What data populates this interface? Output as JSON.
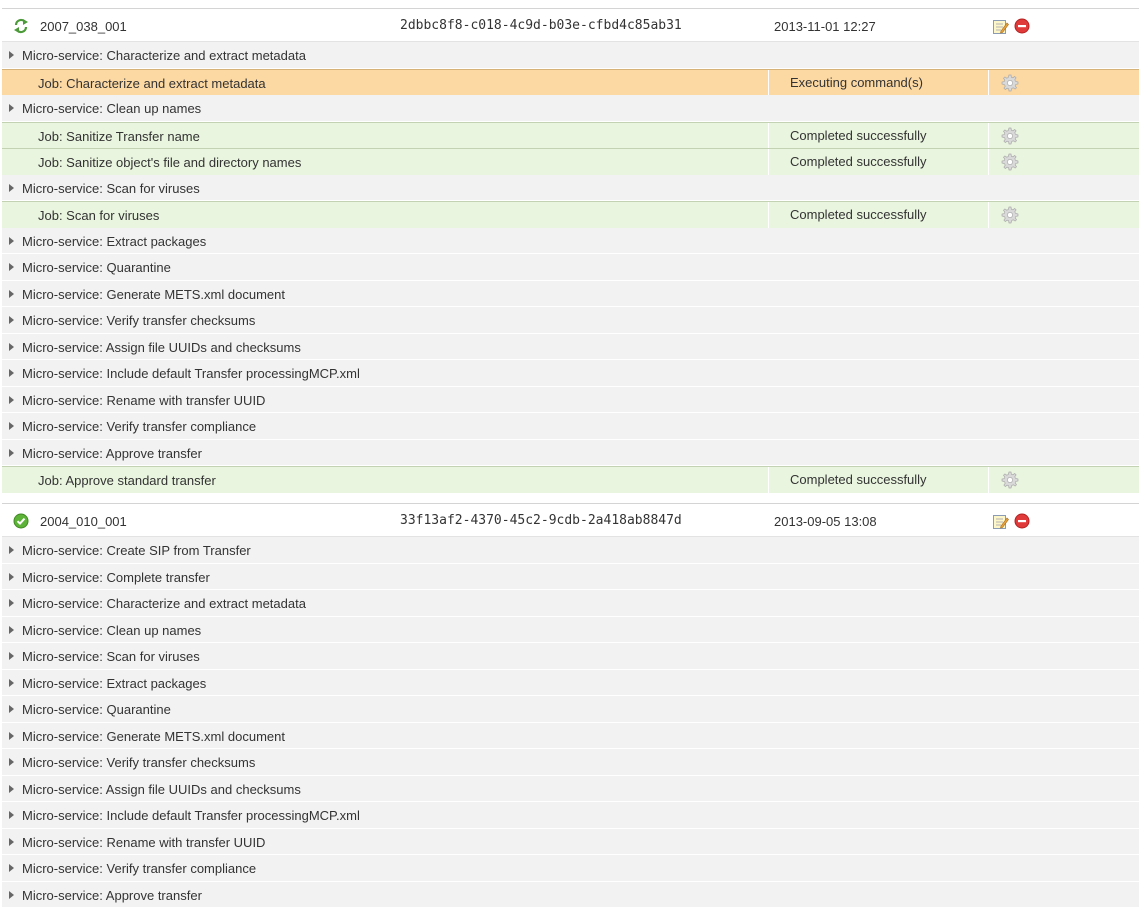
{
  "transfers": [
    {
      "name": "2007_038_001",
      "uuid": "2dbbc8f8-c018-4c9d-b03e-cfbd4c85ab31",
      "date": "2013-11-01 12:27",
      "status_icon": "refresh-processing-icon",
      "rows": [
        {
          "kind": "ms",
          "label": "Micro-service: Characterize and extract metadata"
        },
        {
          "kind": "job",
          "state": "executing",
          "label": "Job: Characterize and extract metadata",
          "status": "Executing command(s)"
        },
        {
          "kind": "ms",
          "label": "Micro-service: Clean up names"
        },
        {
          "kind": "job",
          "state": "done",
          "label": "Job: Sanitize Transfer name",
          "status": "Completed successfully"
        },
        {
          "kind": "job",
          "state": "done",
          "label": "Job: Sanitize object's file and directory names",
          "status": "Completed successfully"
        },
        {
          "kind": "ms",
          "label": "Micro-service: Scan for viruses"
        },
        {
          "kind": "job",
          "state": "done",
          "label": "Job: Scan for viruses",
          "status": "Completed successfully"
        },
        {
          "kind": "ms",
          "label": "Micro-service: Extract packages"
        },
        {
          "kind": "ms",
          "label": "Micro-service: Quarantine"
        },
        {
          "kind": "ms",
          "label": "Micro-service: Generate METS.xml document"
        },
        {
          "kind": "ms",
          "label": "Micro-service: Verify transfer checksums"
        },
        {
          "kind": "ms",
          "label": "Micro-service: Assign file UUIDs and checksums"
        },
        {
          "kind": "ms",
          "label": "Micro-service: Include default Transfer processingMCP.xml"
        },
        {
          "kind": "ms",
          "label": "Micro-service: Rename with transfer UUID"
        },
        {
          "kind": "ms",
          "label": "Micro-service: Verify transfer compliance"
        },
        {
          "kind": "ms",
          "label": "Micro-service: Approve transfer"
        },
        {
          "kind": "job",
          "state": "done",
          "label": "Job: Approve standard transfer",
          "status": "Completed successfully"
        }
      ]
    },
    {
      "name": "2004_010_001",
      "uuid": "33f13af2-4370-45c2-9cdb-2a418ab8847d",
      "date": "2013-09-05 13:08",
      "status_icon": "check-circle-icon",
      "rows": [
        {
          "kind": "ms",
          "label": "Micro-service: Create SIP from Transfer"
        },
        {
          "kind": "ms",
          "label": "Micro-service: Complete transfer"
        },
        {
          "kind": "ms",
          "label": "Micro-service: Characterize and extract metadata"
        },
        {
          "kind": "ms",
          "label": "Micro-service: Clean up names"
        },
        {
          "kind": "ms",
          "label": "Micro-service: Scan for viruses"
        },
        {
          "kind": "ms",
          "label": "Micro-service: Extract packages"
        },
        {
          "kind": "ms",
          "label": "Micro-service: Quarantine"
        },
        {
          "kind": "ms",
          "label": "Micro-service: Generate METS.xml document"
        },
        {
          "kind": "ms",
          "label": "Micro-service: Verify transfer checksums"
        },
        {
          "kind": "ms",
          "label": "Micro-service: Assign file UUIDs and checksums"
        },
        {
          "kind": "ms",
          "label": "Micro-service: Include default Transfer processingMCP.xml"
        },
        {
          "kind": "ms",
          "label": "Micro-service: Rename with transfer UUID"
        },
        {
          "kind": "ms",
          "label": "Micro-service: Verify transfer compliance"
        },
        {
          "kind": "ms",
          "label": "Micro-service: Approve transfer"
        }
      ]
    }
  ],
  "colors": {
    "executing_row": "#fcd8a3",
    "completed_row": "#e9f5df",
    "microservice_row": "#f2f2f2",
    "remove_red": "#e03a3a",
    "check_green": "#5cb338"
  }
}
